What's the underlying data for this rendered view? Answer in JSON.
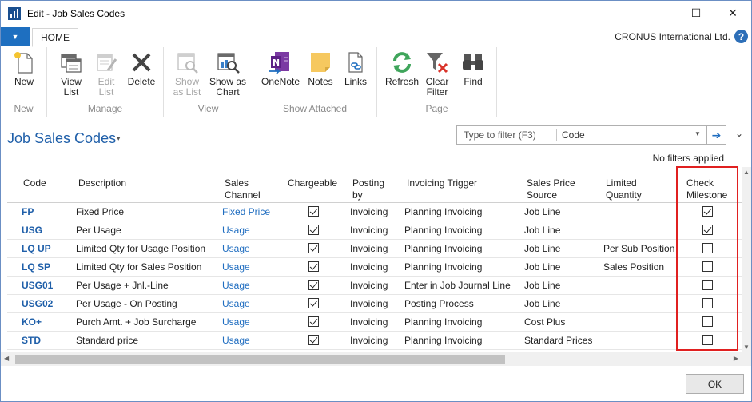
{
  "window": {
    "title": "Edit - Job Sales Codes",
    "minimize": "—",
    "maximize": "☐",
    "close": "✕"
  },
  "ribbon_tabs": {
    "file_glyph": "▼",
    "home": "HOME",
    "company": "CRONUS International Ltd.",
    "help": "?"
  },
  "ribbon": {
    "groups": {
      "new": "New",
      "manage": "Manage",
      "view": "View",
      "show_attached": "Show Attached",
      "page": "Page"
    },
    "buttons": {
      "new": "New",
      "view_list": "View\nList",
      "edit_list": "Edit\nList",
      "delete": "Delete",
      "show_as_list": "Show\nas List",
      "show_as_chart": "Show as\nChart",
      "onenote": "OneNote",
      "notes": "Notes",
      "links": "Links",
      "refresh": "Refresh",
      "clear_filter": "Clear\nFilter",
      "find": "Find"
    }
  },
  "page": {
    "title": "Job Sales Codes",
    "title_caret": "▾",
    "filter_placeholder": "Type to filter (F3)",
    "filter_field": "Code",
    "filter_dropdown": "▼",
    "filter_go": "➔",
    "collapse": "⌄",
    "no_filters": "No filters applied"
  },
  "table": {
    "headers": {
      "code": "Code",
      "description": "Description",
      "sales_channel": "Sales\nChannel",
      "chargeable": "Chargeable",
      "posting_by": "Posting\nby",
      "invoicing_trigger": "Invoicing Trigger",
      "sales_price_source": "Sales Price\nSource",
      "limited_quantity": "Limited\nQuantity",
      "check_milestone": "Check\nMilestone"
    },
    "rows": [
      {
        "code": "FP",
        "description": "Fixed Price",
        "sales_channel": "Fixed Price",
        "chargeable": true,
        "posting_by": "Invoicing",
        "invoicing_trigger": "Planning Invoicing",
        "sales_price_source": "Job Line",
        "limited_quantity": "",
        "check_milestone": true
      },
      {
        "code": "USG",
        "description": "Per Usage",
        "sales_channel": "Usage",
        "chargeable": true,
        "posting_by": "Invoicing",
        "invoicing_trigger": "Planning Invoicing",
        "sales_price_source": "Job Line",
        "limited_quantity": "",
        "check_milestone": true
      },
      {
        "code": "LQ UP",
        "description": "Limited Qty for Usage Position",
        "sales_channel": "Usage",
        "chargeable": true,
        "posting_by": "Invoicing",
        "invoicing_trigger": "Planning Invoicing",
        "sales_price_source": "Job Line",
        "limited_quantity": "Per Sub Position",
        "check_milestone": false
      },
      {
        "code": "LQ SP",
        "description": "Limited Qty for Sales Position",
        "sales_channel": "Usage",
        "chargeable": true,
        "posting_by": "Invoicing",
        "invoicing_trigger": "Planning Invoicing",
        "sales_price_source": "Job Line",
        "limited_quantity": "Sales Position",
        "check_milestone": false
      },
      {
        "code": "USG01",
        "description": "Per Usage + Jnl.-Line",
        "sales_channel": "Usage",
        "chargeable": true,
        "posting_by": "Invoicing",
        "invoicing_trigger": "Enter in Job Journal Line",
        "sales_price_source": "Job Line",
        "limited_quantity": "",
        "check_milestone": false
      },
      {
        "code": "USG02",
        "description": "Per Usage - On Posting",
        "sales_channel": "Usage",
        "chargeable": true,
        "posting_by": "Invoicing",
        "invoicing_trigger": "Posting Process",
        "sales_price_source": "Job Line",
        "limited_quantity": "",
        "check_milestone": false
      },
      {
        "code": "KO+",
        "description": "Purch Amt. + Job Surcharge",
        "sales_channel": "Usage",
        "chargeable": true,
        "posting_by": "Invoicing",
        "invoicing_trigger": "Planning Invoicing",
        "sales_price_source": "Cost Plus",
        "limited_quantity": "",
        "check_milestone": false
      },
      {
        "code": "STD",
        "description": "Standard price",
        "sales_channel": "Usage",
        "chargeable": true,
        "posting_by": "Invoicing",
        "invoicing_trigger": "Planning Invoicing",
        "sales_price_source": "Standard Prices",
        "limited_quantity": "",
        "check_milestone": false
      }
    ]
  },
  "footer": {
    "ok": "OK"
  },
  "colors": {
    "accent": "#1e6fc0",
    "link": "#1f6dc0",
    "highlight": "#e02020"
  }
}
